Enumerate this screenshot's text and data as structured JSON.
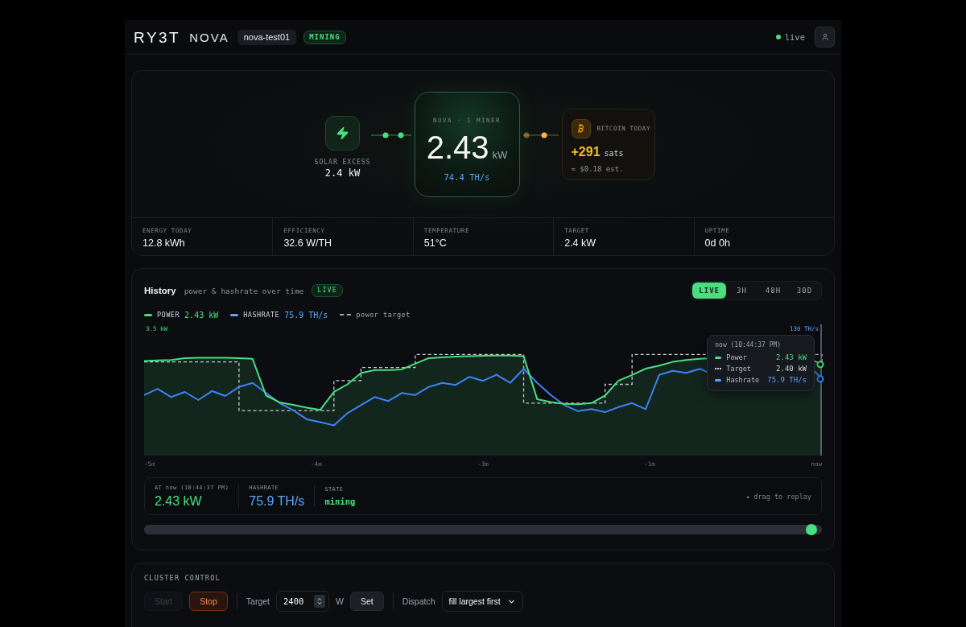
{
  "header": {
    "logo": "RY3T",
    "product": "NOVA",
    "device": "nova-test01",
    "status": "MINING",
    "live": true,
    "live_label": "live"
  },
  "flow": {
    "source": {
      "label": "SOLAR EXCESS",
      "value": "2.4 kW"
    },
    "miner": {
      "title": "NOVA · 1 MINER",
      "power": "2.43",
      "unit": "kW",
      "hashrate": "74.4 TH/s"
    },
    "earnings": {
      "title": "BITCOIN TODAY",
      "amount": "+291",
      "unit": "sats",
      "estimate": "≈ $0.18 est."
    }
  },
  "stats": [
    {
      "label": "ENERGY TODAY",
      "value": "12.8 kWh"
    },
    {
      "label": "EFFICIENCY",
      "value": "32.6 W/TH"
    },
    {
      "label": "TEMPERATURE",
      "value": "51°C"
    },
    {
      "label": "TARGET",
      "value": "2.4 kW"
    },
    {
      "label": "UPTIME",
      "value": "0d 0h"
    }
  ],
  "history": {
    "title": "History",
    "subtitle": "power & hashrate over time",
    "badge": "LIVE",
    "ranges": [
      {
        "label": "LIVE",
        "selected": true
      },
      {
        "label": "3H",
        "selected": false
      },
      {
        "label": "48H",
        "selected": false
      },
      {
        "label": "30D",
        "selected": false
      }
    ],
    "legend": [
      {
        "kind": "solid",
        "name": "POWER",
        "value": "2.43 kW",
        "color": "#4ade80"
      },
      {
        "kind": "solid",
        "name": "HASHRATE",
        "value": "75.9 TH/s",
        "color": "#60a5fa"
      },
      {
        "kind": "dashed",
        "name": "power target",
        "color": "#9ca3af"
      }
    ],
    "left_axis_label": "3.5 kW",
    "right_axis_label": "130 TH/s",
    "x_axis_labels": [
      "-5m",
      "-4m",
      "-3m",
      "-1m",
      "now"
    ],
    "tooltip": {
      "time": "now (10:44:37 PM)",
      "rows": [
        {
          "kind": "solid",
          "name": "Power",
          "value": "2.43 kW",
          "color": "#4ade80"
        },
        {
          "kind": "dotted",
          "name": "Target",
          "value": "2.40 kW",
          "color": "#d1d5db"
        },
        {
          "kind": "solid",
          "name": "Hashrate",
          "value": "75.9 TH/s",
          "color": "#60a5fa"
        }
      ]
    },
    "readout": {
      "time_label": "AT now (10:44:37 PM)",
      "power": "2.43 kW",
      "hashrate_label": "HASHRATE",
      "hashrate": "75.9 TH/s",
      "state_label": "STATE",
      "state": "mining"
    },
    "replay_hint": "◂ drag to replay",
    "scrubber": {
      "level": 1
    }
  },
  "cluster_control": {
    "title": "CLUSTER CONTROL",
    "buttons": [
      {
        "kind": "plain",
        "label": "Start",
        "disabled": true
      },
      {
        "kind": "danger",
        "label": "Stop",
        "disabled": false
      }
    ],
    "target_label": "Target",
    "target_value": "2400",
    "target_unit": "W",
    "set_label": "Set",
    "dispatch_label": "Dispatch",
    "dispatch_value": "fill largest first"
  }
}
